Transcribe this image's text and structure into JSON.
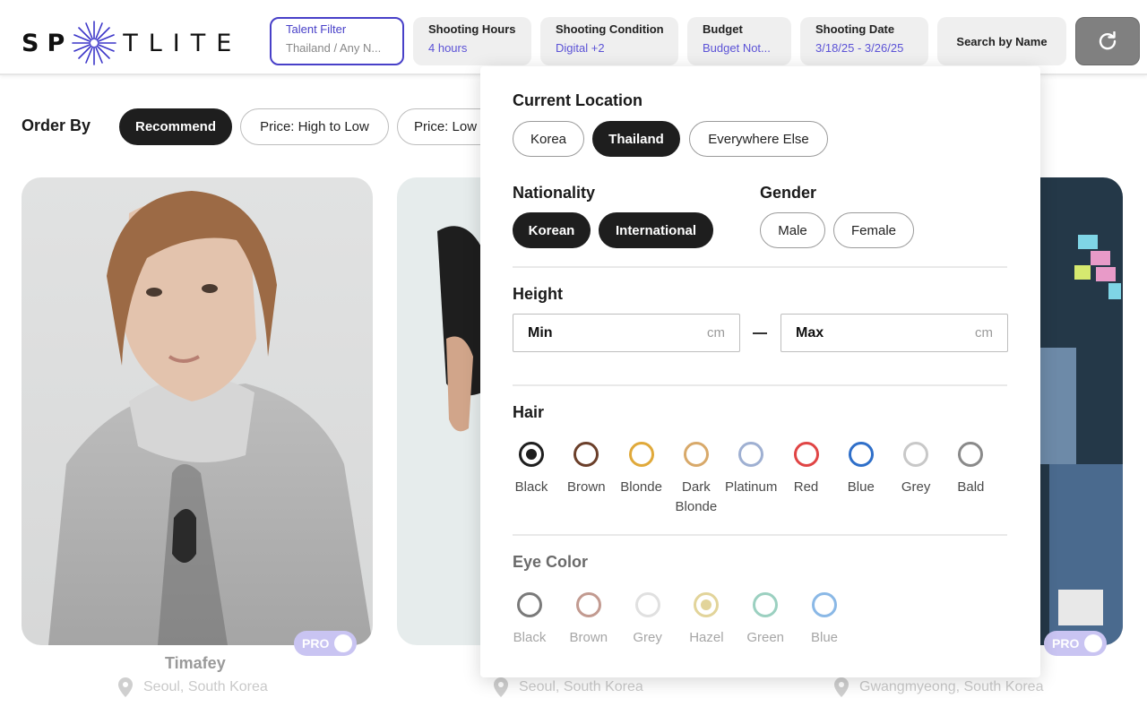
{
  "logo": {
    "left": "SP",
    "right": "TLITE"
  },
  "filters": [
    {
      "title": "Talent Filter",
      "value": "Thailand / Any N..."
    },
    {
      "title": "Shooting Hours",
      "value": "4 hours"
    },
    {
      "title": "Shooting Condition",
      "value": "Digital +2"
    },
    {
      "title": "Budget",
      "value": "Budget Not..."
    },
    {
      "title": "Shooting Date",
      "value": "3/18/25 - 3/26/25"
    }
  ],
  "search_by_name": "Search by Name",
  "reset_icon": "refresh-icon",
  "order": {
    "label": "Order By",
    "options": [
      "Recommend",
      "Price: High to Low",
      "Price: Low"
    ],
    "selected": "Recommend"
  },
  "cards": [
    {
      "name": "Timafey",
      "location": "Seoul, South Korea",
      "badge": "PRO"
    },
    {
      "name": "",
      "location": "Seoul, South Korea",
      "badge": ""
    },
    {
      "name": "",
      "location": "Gwangmyeong, South Korea",
      "badge": "PRO"
    }
  ],
  "panel": {
    "current_location": {
      "title": "Current Location",
      "options": [
        "Korea",
        "Thailand",
        "Everywhere Else"
      ],
      "selected": "Thailand"
    },
    "nationality": {
      "title": "Nationality",
      "options": [
        "Korean",
        "International"
      ],
      "selected": [
        "Korean",
        "International"
      ]
    },
    "gender": {
      "title": "Gender",
      "options": [
        "Male",
        "Female"
      ]
    },
    "height": {
      "title": "Height",
      "min": "Min",
      "max": "Max",
      "unit": "cm"
    },
    "hair": {
      "title": "Hair",
      "options": [
        {
          "label": "Black",
          "color": "#1e1e1e",
          "selected": true
        },
        {
          "label": "Brown",
          "color": "#6b3f2a"
        },
        {
          "label": "Blonde",
          "color": "#e0a93a"
        },
        {
          "label": "Dark Blonde",
          "color": "#d8a96a"
        },
        {
          "label": "Platinum",
          "color": "#9fb0d2"
        },
        {
          "label": "Red",
          "color": "#e04545"
        },
        {
          "label": "Blue",
          "color": "#2f6fc9"
        },
        {
          "label": "Grey",
          "color": "#c8c8c8"
        },
        {
          "label": "Bald",
          "color": "#8a8a8a"
        }
      ]
    },
    "eye_color": {
      "title": "Eye Color",
      "options": [
        {
          "label": "Black",
          "color": "#7a7a7a"
        },
        {
          "label": "Brown",
          "color": "#c29a90"
        },
        {
          "label": "Grey",
          "color": "#e0e0e0"
        },
        {
          "label": "Hazel",
          "color": "#e2d49a",
          "selected": true
        },
        {
          "label": "Green",
          "color": "#9bd0c0"
        },
        {
          "label": "Blue",
          "color": "#8ab8e6"
        }
      ]
    }
  }
}
